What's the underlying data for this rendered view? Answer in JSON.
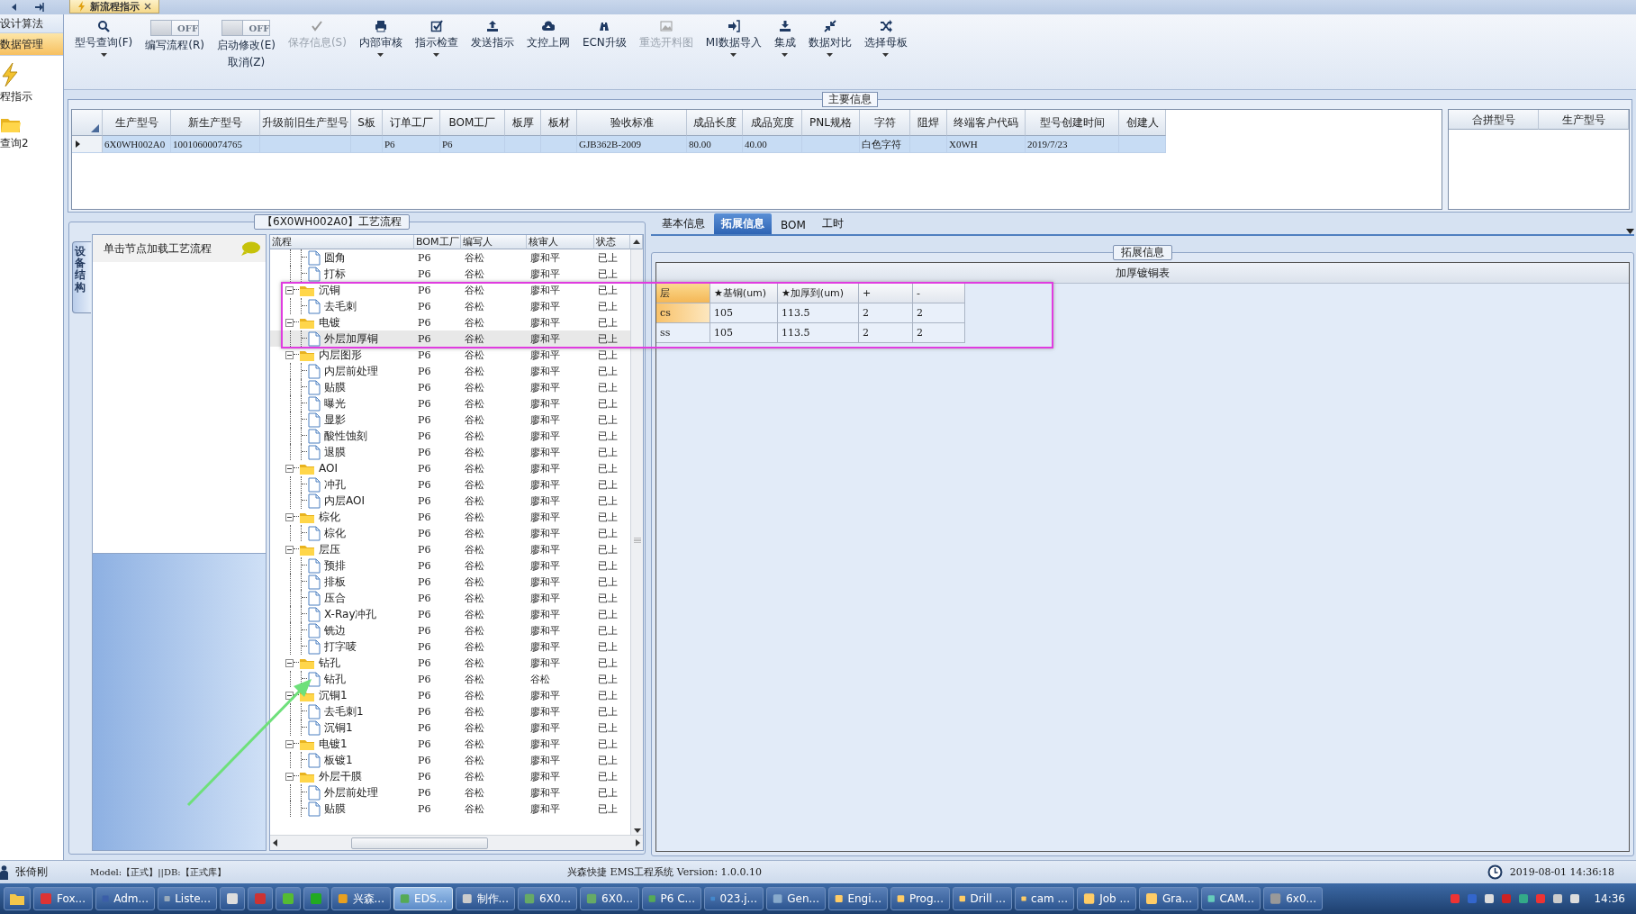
{
  "document_tab": {
    "label": "新流程指示"
  },
  "sidebar": {
    "items": [
      {
        "kind": "text",
        "label": "设计算法",
        "selected": false
      },
      {
        "kind": "text",
        "label": "数据管理",
        "selected": true
      },
      {
        "kind": "lightning",
        "label": "程指示",
        "selected": false
      },
      {
        "kind": "folder",
        "label": "查询2",
        "selected": false
      }
    ]
  },
  "toolbar": {
    "items": [
      {
        "kind": "button",
        "label": "型号查询(F)",
        "dropdown": true,
        "disabled": false
      },
      {
        "kind": "toggle",
        "toggle_text": "OFF",
        "on": false,
        "label": "编写流程(R)"
      },
      {
        "kind": "toggle",
        "toggle_text": "OFF",
        "on": false,
        "label": "启动修改(E)",
        "sublabel": "取消(Z)"
      },
      {
        "kind": "button",
        "label": "保存信息(S)",
        "dropdown": false,
        "disabled": true
      },
      {
        "kind": "button",
        "label": "内部审核",
        "dropdown": true,
        "disabled": false
      },
      {
        "kind": "button",
        "label": "指示检查",
        "dropdown": true,
        "disabled": false
      },
      {
        "kind": "button",
        "label": "发送指示",
        "dropdown": false,
        "disabled": false
      },
      {
        "kind": "button",
        "label": "文控上网",
        "dropdown": false,
        "disabled": false
      },
      {
        "kind": "button",
        "label": "ECN升级",
        "dropdown": false,
        "disabled": false
      },
      {
        "kind": "button",
        "label": "重选开料图",
        "dropdown": false,
        "disabled": true
      },
      {
        "kind": "button",
        "label": "MI数据导入",
        "dropdown": true,
        "disabled": false
      },
      {
        "kind": "button",
        "label": "集成",
        "dropdown": true,
        "disabled": false
      },
      {
        "kind": "button",
        "label": "数据对比",
        "dropdown": true,
        "disabled": false
      },
      {
        "kind": "button",
        "label": "选择母板",
        "dropdown": true,
        "disabled": false
      }
    ]
  },
  "main_info": {
    "title": "主要信息",
    "table": {
      "columns": [
        "生产型号",
        "新生产型号",
        "升级前旧生产型号",
        "S板",
        "订单工厂",
        "BOM工厂",
        "板厚",
        "板材",
        "验收标准",
        "成品长度",
        "成品宽度",
        "PNL规格",
        "字符",
        "阻焊",
        "终端客户代码",
        "型号创建时间",
        "创建人"
      ],
      "rows": [
        {
          "selected": true,
          "cells": [
            "6X0WH002A0",
            "10010600074765",
            null,
            null,
            "P6",
            "P6",
            null,
            null,
            "GJB362B-2009",
            "80.00",
            "40.00",
            null,
            "白色字符",
            null,
            "X0WH",
            "2019/7/23",
            null
          ]
        }
      ]
    },
    "side_table": {
      "columns": [
        "合拼型号",
        "生产型号"
      ]
    }
  },
  "flow": {
    "title": "【6X0WH002A0】工艺流程",
    "side_tab": "设备结构",
    "node_panel": {
      "label": "单击节点加载工艺流程"
    },
    "tree": {
      "columns": [
        "流程",
        "BOM工厂",
        "编写人",
        "核审人",
        "状态"
      ],
      "nodes": [
        {
          "children": [
            {
              "name": "圆角",
              "bom": "P6",
              "writer": "谷松",
              "reviewer": "廖和平",
              "status": "已上",
              "selected": false
            },
            {
              "name": "打标",
              "bom": "P6",
              "writer": "谷松",
              "reviewer": "廖和平",
              "status": "已上",
              "selected": false
            }
          ]
        },
        {
          "name": "沉铜",
          "bom": "P6",
          "writer": "谷松",
          "reviewer": "廖和平",
          "status": "已上",
          "selected": false,
          "expanded": true,
          "children": [
            {
              "name": "去毛刺",
              "bom": "P6",
              "writer": "谷松",
              "reviewer": "廖和平",
              "status": "已上",
              "selected": false
            }
          ]
        },
        {
          "name": "电镀",
          "bom": "P6",
          "writer": "谷松",
          "reviewer": "廖和平",
          "status": "已上",
          "selected": false,
          "expanded": true,
          "children": [
            {
              "name": "外层加厚铜",
              "bom": "P6",
              "writer": "谷松",
              "reviewer": "廖和平",
              "status": "已上",
              "selected": true
            }
          ]
        },
        {
          "name": "内层图形",
          "bom": "P6",
          "writer": "谷松",
          "reviewer": "廖和平",
          "status": "已上",
          "selected": false,
          "expanded": true,
          "children": [
            {
              "name": "内层前处理",
              "bom": "P6",
              "writer": "谷松",
              "reviewer": "廖和平",
              "status": "已上",
              "selected": false
            },
            {
              "name": "贴膜",
              "bom": "P6",
              "writer": "谷松",
              "reviewer": "廖和平",
              "status": "已上",
              "selected": false
            },
            {
              "name": "曝光",
              "bom": "P6",
              "writer": "谷松",
              "reviewer": "廖和平",
              "status": "已上",
              "selected": false
            },
            {
              "name": "显影",
              "bom": "P6",
              "writer": "谷松",
              "reviewer": "廖和平",
              "status": "已上",
              "selected": false
            },
            {
              "name": "酸性蚀刻",
              "bom": "P6",
              "writer": "谷松",
              "reviewer": "廖和平",
              "status": "已上",
              "selected": false
            },
            {
              "name": "退膜",
              "bom": "P6",
              "writer": "谷松",
              "reviewer": "廖和平",
              "status": "已上",
              "selected": false
            }
          ]
        },
        {
          "name": "AOI",
          "bom": "P6",
          "writer": "谷松",
          "reviewer": "廖和平",
          "status": "已上",
          "selected": false,
          "expanded": true,
          "children": [
            {
              "name": "冲孔",
              "bom": "P6",
              "writer": "谷松",
              "reviewer": "廖和平",
              "status": "已上",
              "selected": false
            },
            {
              "name": "内层AOI",
              "bom": "P6",
              "writer": "谷松",
              "reviewer": "廖和平",
              "status": "已上",
              "selected": false
            }
          ]
        },
        {
          "name": "棕化",
          "bom": "P6",
          "writer": "谷松",
          "reviewer": "廖和平",
          "status": "已上",
          "selected": false,
          "expanded": true,
          "children": [
            {
              "name": "棕化",
              "bom": "P6",
              "writer": "谷松",
              "reviewer": "廖和平",
              "status": "已上",
              "selected": false
            }
          ]
        },
        {
          "name": "层压",
          "bom": "P6",
          "writer": "谷松",
          "reviewer": "廖和平",
          "status": "已上",
          "selected": false,
          "expanded": true,
          "children": [
            {
              "name": "预排",
              "bom": "P6",
              "writer": "谷松",
              "reviewer": "廖和平",
              "status": "已上",
              "selected": false
            },
            {
              "name": "排板",
              "bom": "P6",
              "writer": "谷松",
              "reviewer": "廖和平",
              "status": "已上",
              "selected": false
            },
            {
              "name": "压合",
              "bom": "P6",
              "writer": "谷松",
              "reviewer": "廖和平",
              "status": "已上",
              "selected": false
            },
            {
              "name": "X-Ray冲孔",
              "bom": "P6",
              "writer": "谷松",
              "reviewer": "廖和平",
              "status": "已上",
              "selected": false
            },
            {
              "name": "铣边",
              "bom": "P6",
              "writer": "谷松",
              "reviewer": "廖和平",
              "status": "已上",
              "selected": false
            },
            {
              "name": "打字唛",
              "bom": "P6",
              "writer": "谷松",
              "reviewer": "廖和平",
              "status": "已上",
              "selected": false
            }
          ]
        },
        {
          "name": "钻孔",
          "bom": "P6",
          "writer": "谷松",
          "reviewer": "廖和平",
          "status": "已上",
          "selected": false,
          "expanded": true,
          "children": [
            {
              "name": "钻孔",
              "bom": "P6",
              "writer": "谷松",
              "reviewer": "谷松",
              "status": "已上",
              "selected": false
            }
          ]
        },
        {
          "name": "沉铜1",
          "bom": "P6",
          "writer": "谷松",
          "reviewer": "廖和平",
          "status": "已上",
          "selected": false,
          "expanded": true,
          "children": [
            {
              "name": "去毛刺1",
              "bom": "P6",
              "writer": "谷松",
              "reviewer": "廖和平",
              "status": "已上",
              "selected": false
            },
            {
              "name": "沉铜1",
              "bom": "P6",
              "writer": "谷松",
              "reviewer": "廖和平",
              "status": "已上",
              "selected": false
            }
          ]
        },
        {
          "name": "电镀1",
          "bom": "P6",
          "writer": "谷松",
          "reviewer": "廖和平",
          "status": "已上",
          "selected": false,
          "expanded": true,
          "children": [
            {
              "name": "板镀1",
              "bom": "P6",
              "writer": "谷松",
              "reviewer": "廖和平",
              "status": "已上",
              "selected": false
            }
          ]
        },
        {
          "name": "外层干膜",
          "bom": "P6",
          "writer": "谷松",
          "reviewer": "廖和平",
          "status": "已上",
          "selected": false,
          "expanded": true,
          "children": [
            {
              "name": "外层前处理",
              "bom": "P6",
              "writer": "谷松",
              "reviewer": "廖和平",
              "status": "已上",
              "selected": false
            },
            {
              "name": "贴膜",
              "bom": "P6",
              "writer": "谷松",
              "reviewer": "廖和平",
              "status": "已上",
              "selected": false
            }
          ]
        }
      ]
    }
  },
  "extended": {
    "tabs": [
      {
        "label": "基本信息",
        "selected": false
      },
      {
        "label": "拓展信息",
        "selected": true
      },
      {
        "label": "BOM",
        "selected": false
      },
      {
        "label": "工时",
        "selected": false
      }
    ],
    "group_title": "拓展信息",
    "table_title": "加厚镀铜表",
    "columns": [
      "层",
      "★基铜(um)",
      "★加厚到(um)",
      "+",
      "-"
    ],
    "rows": [
      {
        "selected": true,
        "cells": [
          "cs",
          "105",
          "113.5",
          "2",
          "2"
        ]
      },
      {
        "selected": false,
        "cells": [
          "ss",
          "105",
          "113.5",
          "2",
          "2"
        ]
      }
    ]
  },
  "annotations": [
    {
      "kind": "highlight_box",
      "color": "#e03ce0"
    },
    {
      "kind": "arrow",
      "color": "#6ee07a"
    }
  ],
  "status_bar": {
    "user": "张倚刚",
    "model": "Model:【正式】||DB:【正式库】",
    "app": "兴森快捷 EMS工程系统 Version: 1.0.0.10",
    "datetime": "2019-08-01 14:36:18"
  },
  "taskbar": {
    "items": [
      {
        "label": "Fox...",
        "active": false
      },
      {
        "label": "Adm...",
        "active": false
      },
      {
        "label": "Liste...",
        "active": false
      },
      {
        "active": false
      },
      {
        "active": false
      },
      {
        "active": false
      },
      {
        "active": false
      },
      {
        "label": "兴森...",
        "active": false
      },
      {
        "label": "EDS...",
        "active": true
      },
      {
        "label": "制作...",
        "active": false
      },
      {
        "label": "6X0...",
        "active": false
      },
      {
        "label": "6X0...",
        "active": false
      },
      {
        "label": "P6 C...",
        "active": false
      },
      {
        "label": "023.j...",
        "active": false
      },
      {
        "label": "Gen...",
        "active": false
      },
      {
        "label": "Engi...",
        "active": false
      },
      {
        "label": "Prog...",
        "active": false
      },
      {
        "label": "Drill ...",
        "active": false
      },
      {
        "label": "cam ...",
        "active": false
      },
      {
        "label": "Job ...",
        "active": false
      },
      {
        "label": "Gra...",
        "active": false
      },
      {
        "label": "CAM...",
        "active": false
      },
      {
        "label": "6x0...",
        "active": false
      }
    ],
    "clock": "14:36"
  }
}
